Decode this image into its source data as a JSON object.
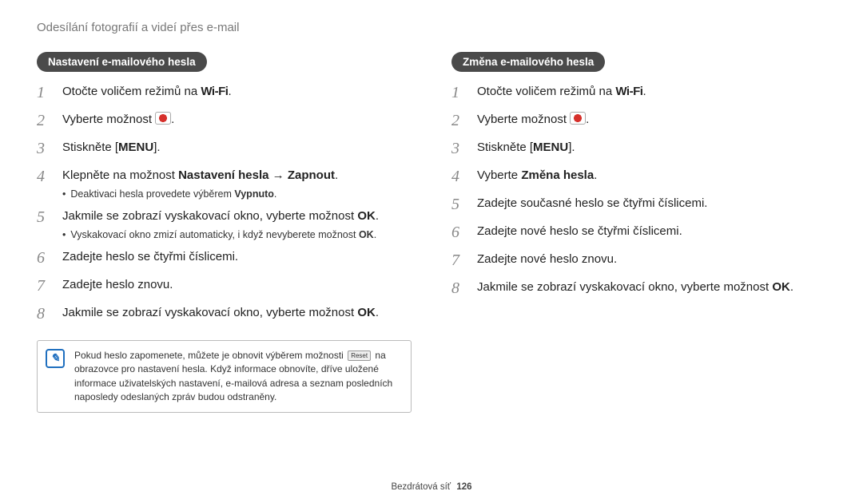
{
  "header": "Odesílání fotografií a videí přes e-mail",
  "left": {
    "title": "Nastavení e-mailového hesla",
    "steps": [
      {
        "pre": "Otočte voličem režimů na ",
        "wifi": "Wi-Fi",
        "post": "."
      },
      {
        "pre": "Vyberte možnost ",
        "emailicon": true,
        "post": "."
      },
      {
        "pre": "Stiskněte [",
        "menu": "MENU",
        "post": "]."
      },
      {
        "pre": "Klepněte na možnost ",
        "bold": "Nastavení hesla",
        "arrow": " → ",
        "bold2": "Zapnout",
        "post": ".",
        "sub": {
          "pre": "Deaktivaci hesla provedete výběrem ",
          "bold": "Vypnuto",
          "post": "."
        }
      },
      {
        "pre": "Jakmile se zobrazí vyskakovací okno, vyberte možnost ",
        "bold": "OK",
        "post": ".",
        "sub": {
          "pre": "Vyskakovací okno zmizí automaticky, i když nevyberete možnost ",
          "bold": "OK",
          "post": "."
        }
      },
      {
        "plain": "Zadejte heslo se čtyřmi číslicemi."
      },
      {
        "plain": "Zadejte heslo znovu."
      },
      {
        "pre": "Jakmile se zobrazí vyskakovací okno, vyberte možnost ",
        "bold": "OK",
        "post": "."
      }
    ],
    "note": {
      "pre": "Pokud heslo zapomenete, můžete je obnovit výběrem možnosti ",
      "reset": "Reset",
      "post": " na obrazovce pro nastavení hesla. Když informace obnovíte, dříve uložené informace uživatelských nastavení, e-mailová adresa a seznam posledních naposledy odeslaných zpráv budou odstraněny."
    }
  },
  "right": {
    "title": "Změna e-mailového hesla",
    "steps": [
      {
        "pre": "Otočte voličem režimů na ",
        "wifi": "Wi-Fi",
        "post": "."
      },
      {
        "pre": "Vyberte možnost ",
        "emailicon": true,
        "post": "."
      },
      {
        "pre": "Stiskněte [",
        "menu": "MENU",
        "post": "]."
      },
      {
        "pre": "Vyberte ",
        "bold": "Změna hesla",
        "post": "."
      },
      {
        "plain": "Zadejte současné heslo se čtyřmi číslicemi."
      },
      {
        "plain": "Zadejte nové heslo se čtyřmi číslicemi."
      },
      {
        "plain": "Zadejte nové heslo znovu."
      },
      {
        "pre": "Jakmile se zobrazí vyskakovací okno, vyberte možnost ",
        "bold": "OK",
        "post": "."
      }
    ]
  },
  "footer": {
    "label": "Bezdrátová síť",
    "page": "126"
  }
}
